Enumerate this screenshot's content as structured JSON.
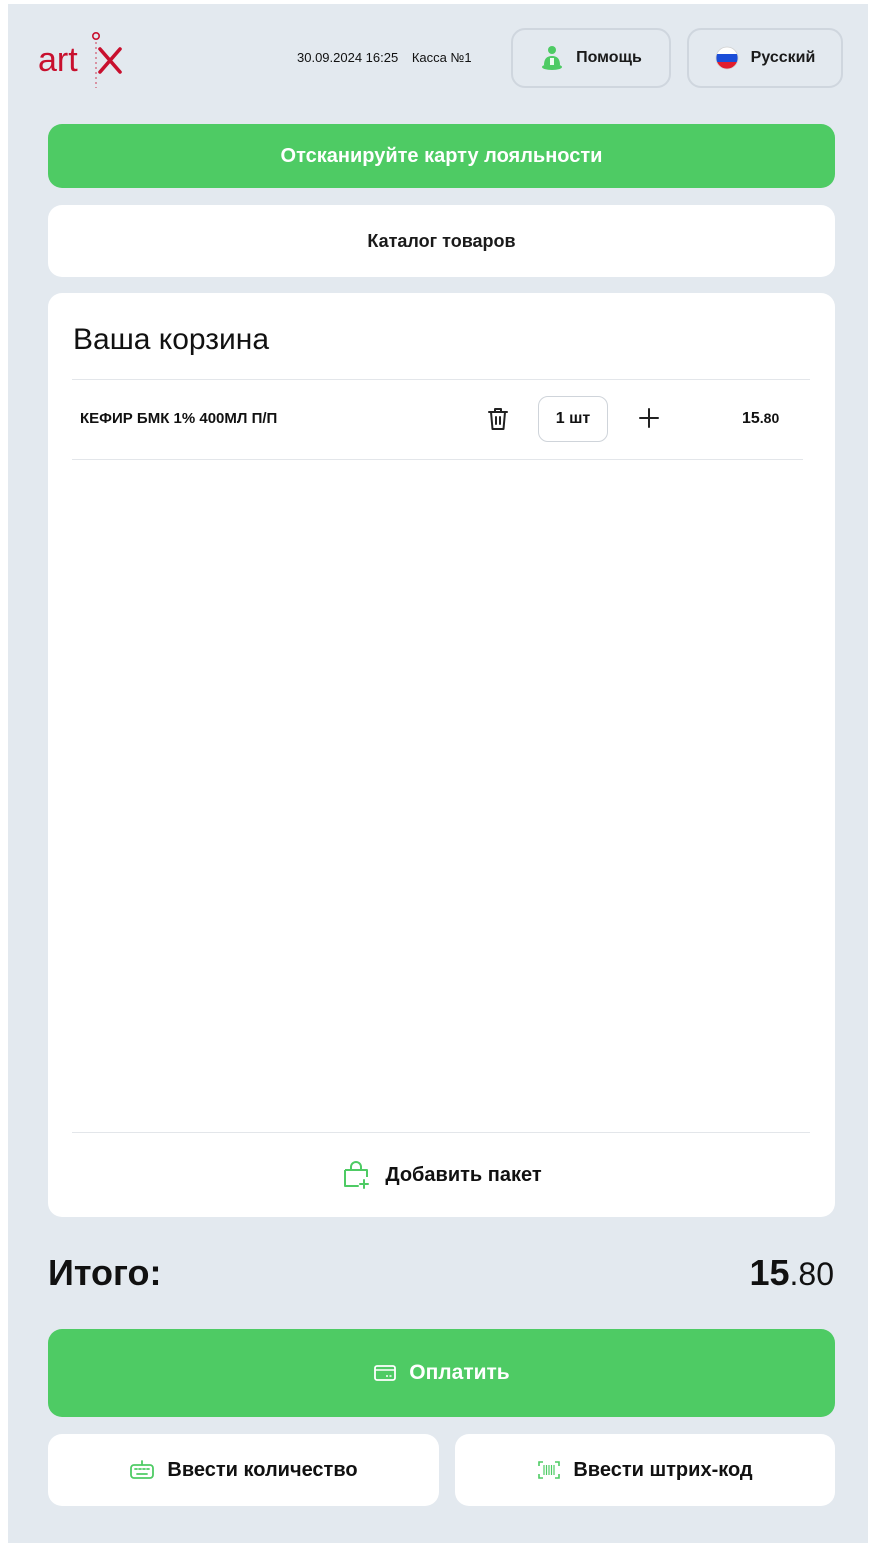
{
  "header": {
    "logo_text": "artix",
    "datetime": "30.09.2024 16:25",
    "register": "Касса №1",
    "help_label": "Помощь",
    "language_label": "Русский"
  },
  "loyalty_button_label": "Отсканируйте карту лояльности",
  "catalog_button_label": "Каталог товаров",
  "cart": {
    "title": "Ваша корзина",
    "items": [
      {
        "name": "КЕФИР БМК 1% 400МЛ П/П",
        "quantity": "1 шт",
        "price_rub": "15",
        "price_kop": ".80"
      }
    ],
    "add_bag_label": "Добавить пакет"
  },
  "total": {
    "label": "Итого:",
    "rub": "15",
    "kop": ".80"
  },
  "pay_button_label": "Оплатить",
  "enter_quantity_label": "Ввести количество",
  "enter_barcode_label": "Ввести штрих-код",
  "colors": {
    "accent_green": "#4ecb64",
    "logo_red": "#c8102e",
    "background": "#e3e9ef"
  },
  "icons": {
    "help": "person-assistant-icon",
    "language": "russia-flag-icon",
    "delete": "trash-icon",
    "increase": "plus-icon",
    "add_bag": "shopping-bag-plus-icon",
    "pay": "credit-card-icon",
    "quantity": "keyboard-icon",
    "barcode": "barcode-scan-icon"
  }
}
